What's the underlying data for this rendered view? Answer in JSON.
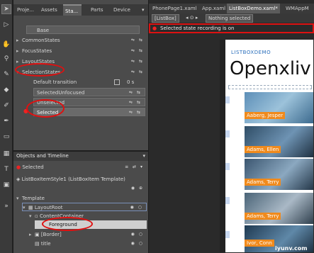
{
  "toolbar": {
    "tools": [
      "selection-tool",
      "direct-select-tool",
      "pan-tool",
      "eyedropper-tool",
      "brush-tool",
      "paint-bucket-tool",
      "pen-tool",
      "pencil-tool",
      "rectangle-tool",
      "layout-panel-tool",
      "text-tool",
      "control-tool",
      "assets-tool"
    ]
  },
  "states_panel": {
    "tabs": [
      "Proje...",
      "Assets",
      "Sta...",
      "Parts",
      "Device"
    ],
    "active_tab": "Sta...",
    "base_label": "Base",
    "groups": [
      "CommonStates",
      "FocusStates",
      "LayoutStates",
      "SelectionStates"
    ],
    "default_transition": "Default transition",
    "default_transition_value": "0 s",
    "states": [
      "SelectedUnfocused",
      "Unselected",
      "Selected"
    ]
  },
  "objects_panel": {
    "title": "Objects and Timeline",
    "selected_label": "Selected",
    "template_label": "ListBoxItemStyle1 (ListBoxItem Template)",
    "tree": [
      "Template",
      "LayoutRoot",
      "ContentContainer",
      "Foreground",
      "[Border]",
      "title"
    ]
  },
  "document": {
    "tabs": [
      "PhonePage1.xaml",
      "App.xaml",
      "ListBoxDemo.xaml*",
      "WMAppM"
    ],
    "active_tab": "ListBoxDemo.xaml*",
    "breadcrumb_item": "[ListBox]",
    "breadcrumb_status": "Nothing selected",
    "recording_text": "Selected state recording is on",
    "app_title": "LISTBOXDEMO",
    "page_title": "Openxliv",
    "items": [
      "Aaberg, Jesper",
      "Adams, Ellen",
      "Adams, Terry",
      "Adams, Terry",
      "Ivor, Conn"
    ],
    "watermark": "iyunv.com"
  },
  "colors": {
    "recording_border": "#dd1111",
    "highlight_oval": "#e01010",
    "item_name_bg": "#f08a1c",
    "accent_title": "#2a6ebb"
  }
}
